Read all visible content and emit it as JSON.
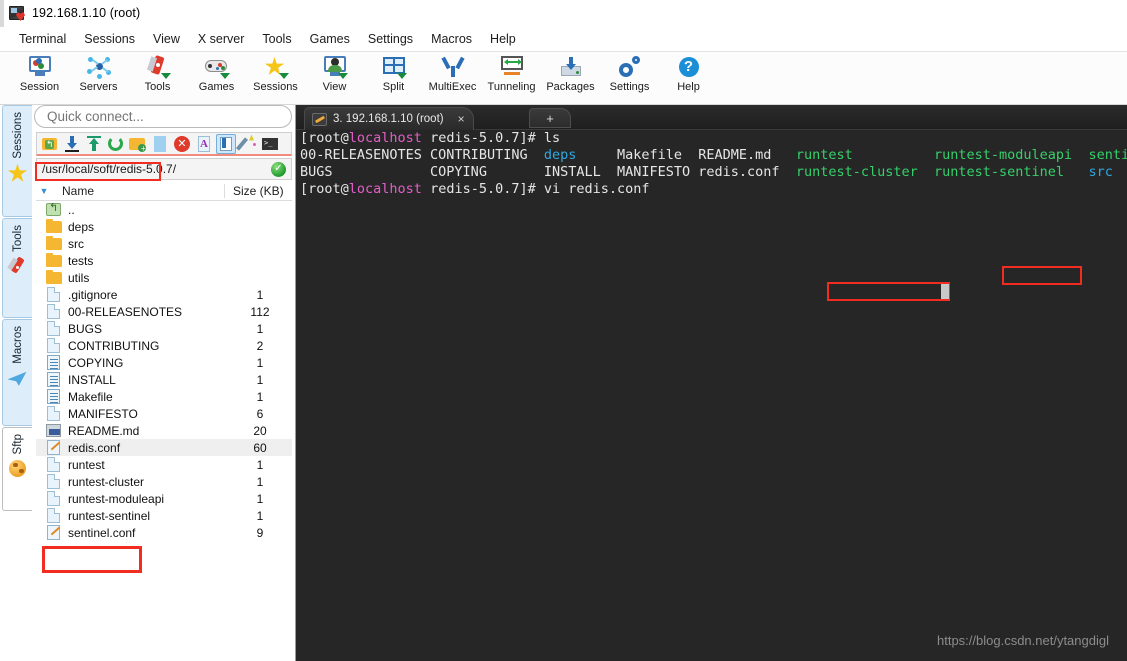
{
  "window": {
    "title": "192.168.1.10 (root)",
    "app_icon": "mobaxterm-icon"
  },
  "menubar": {
    "items": [
      {
        "label": "Terminal"
      },
      {
        "label": "Sessions"
      },
      {
        "label": "View"
      },
      {
        "label": "X server"
      },
      {
        "label": "Tools"
      },
      {
        "label": "Games"
      },
      {
        "label": "Settings"
      },
      {
        "label": "Macros"
      },
      {
        "label": "Help"
      }
    ]
  },
  "toolbar": {
    "buttons": [
      {
        "label": "Session",
        "icon": "session-monitor-icon"
      },
      {
        "label": "Servers",
        "icon": "servers-network-icon"
      },
      {
        "label": "Tools",
        "icon": "tools-swissknife-icon"
      },
      {
        "label": "Games",
        "icon": "games-gamepad-icon"
      },
      {
        "label": "Sessions",
        "icon": "sessions-star-icon"
      },
      {
        "label": "View",
        "icon": "view-user-monitor-icon"
      },
      {
        "label": "Split",
        "icon": "split-panes-icon"
      },
      {
        "label": "MultiExec",
        "icon": "multiexec-fork-icon"
      },
      {
        "label": "Tunneling",
        "icon": "tunneling-monitor-arrows-icon"
      },
      {
        "label": "Packages",
        "icon": "packages-download-box-icon"
      },
      {
        "label": "Settings",
        "icon": "settings-gears-icon"
      },
      {
        "label": "Help",
        "icon": "help-question-icon"
      }
    ]
  },
  "side_tabs": {
    "collapse_icon": "double-chevron-left-icon",
    "items": [
      {
        "label": "Sessions",
        "icon": "star-icon",
        "active": false
      },
      {
        "label": "Tools",
        "icon": "swissknife-icon",
        "active": false
      },
      {
        "label": "Macros",
        "icon": "paperplane-icon",
        "active": false
      },
      {
        "label": "Sftp",
        "icon": "globe-icon",
        "active": true
      }
    ]
  },
  "sftp_panel": {
    "quick_connect": {
      "value": "",
      "placeholder": "Quick connect..."
    },
    "toolbar_icons": [
      {
        "name": "parent-folder-icon",
        "selected": false
      },
      {
        "name": "download-icon",
        "selected": false
      },
      {
        "name": "upload-icon",
        "selected": false
      },
      {
        "name": "refresh-icon",
        "selected": false
      },
      {
        "name": "new-folder-icon",
        "selected": false
      },
      {
        "name": "new-file-icon",
        "selected": false
      },
      {
        "name": "delete-icon",
        "selected": false
      },
      {
        "name": "text-mode-icon",
        "selected": false
      },
      {
        "name": "follow-terminal-folder-icon",
        "selected": true
      },
      {
        "name": "magic-wand-icon",
        "selected": false
      },
      {
        "name": "open-terminal-icon",
        "selected": false
      }
    ],
    "path": {
      "value": "/usr/local/soft/redis-5.0.7/",
      "status_icon": "ok-check-icon",
      "highlighted": true
    },
    "columns": [
      "Name",
      "Size (KB)"
    ],
    "sort_caret": "▼",
    "files": [
      {
        "name": "..",
        "size": "",
        "type": "parent",
        "selected": false
      },
      {
        "name": "deps",
        "size": "",
        "type": "folder",
        "selected": false
      },
      {
        "name": "src",
        "size": "",
        "type": "folder",
        "selected": false
      },
      {
        "name": "tests",
        "size": "",
        "type": "folder",
        "selected": false
      },
      {
        "name": "utils",
        "size": "",
        "type": "folder",
        "selected": false
      },
      {
        "name": ".gitignore",
        "size": "1",
        "type": "file",
        "selected": false
      },
      {
        "name": "00-RELEASENOTES",
        "size": "112",
        "type": "file",
        "selected": false
      },
      {
        "name": "BUGS",
        "size": "1",
        "type": "file",
        "selected": false
      },
      {
        "name": "CONTRIBUTING",
        "size": "2",
        "type": "file",
        "selected": false
      },
      {
        "name": "COPYING",
        "size": "1",
        "type": "text",
        "selected": false
      },
      {
        "name": "INSTALL",
        "size": "1",
        "type": "text",
        "selected": false
      },
      {
        "name": "Makefile",
        "size": "1",
        "type": "text",
        "selected": false
      },
      {
        "name": "MANIFESTO",
        "size": "6",
        "type": "file",
        "selected": false
      },
      {
        "name": "README.md",
        "size": "20",
        "type": "markdown",
        "selected": false
      },
      {
        "name": "redis.conf",
        "size": "60",
        "type": "conf",
        "selected": true
      },
      {
        "name": "runtest",
        "size": "1",
        "type": "file",
        "selected": false
      },
      {
        "name": "runtest-cluster",
        "size": "1",
        "type": "file",
        "selected": false
      },
      {
        "name": "runtest-moduleapi",
        "size": "1",
        "type": "file",
        "selected": false
      },
      {
        "name": "runtest-sentinel",
        "size": "1",
        "type": "file",
        "selected": false
      },
      {
        "name": "sentinel.conf",
        "size": "9",
        "type": "conf",
        "selected": false
      }
    ]
  },
  "terminal": {
    "tab": {
      "label": "3. 192.168.1.10 (root)",
      "icon": "key-icon",
      "close_icon": "×",
      "new_tab_icon": "+"
    },
    "lines": [
      [
        {
          "text": "[root@",
          "color": "white"
        },
        {
          "text": "localhost",
          "color": "pink"
        },
        {
          "text": " redis-5.0.7]# ls",
          "color": "white"
        }
      ],
      [
        {
          "text": "00-RELEASENOTES ",
          "color": "white"
        },
        {
          "text": "CONTRIBUTING  ",
          "color": "white"
        },
        {
          "text": "deps     ",
          "color": "blue"
        },
        {
          "text": "Makefile  ",
          "color": "white"
        },
        {
          "text": "README.md   ",
          "color": "white"
        },
        {
          "text": "runtest          ",
          "color": "green"
        },
        {
          "text": "runtest-moduleapi  ",
          "color": "green"
        },
        {
          "text": "senti",
          "color": "green"
        }
      ],
      [
        {
          "text": "BUGS            ",
          "color": "white"
        },
        {
          "text": "COPYING       ",
          "color": "white"
        },
        {
          "text": "INSTALL  ",
          "color": "white"
        },
        {
          "text": "MANIFESTO ",
          "color": "white"
        },
        {
          "text": "redis.conf  ",
          "color": "white"
        },
        {
          "text": "runtest-cluster  ",
          "color": "green"
        },
        {
          "text": "runtest-sentinel   ",
          "color": "green"
        },
        {
          "text": "src",
          "color": "blue"
        }
      ],
      [
        {
          "text": "[root@",
          "color": "white"
        },
        {
          "text": "localhost",
          "color": "pink"
        },
        {
          "text": " redis-5.0.7]# ",
          "color": "white"
        },
        {
          "text": "vi redis.conf",
          "color": "white"
        }
      ]
    ],
    "highlight_boxes": [
      "redis.conf",
      "vi redis.conf"
    ],
    "cursor": "block"
  },
  "watermark": {
    "text": "https://blog.csdn.net/ytangdigl"
  },
  "colors": {
    "accent_blue": "#2a7ac0",
    "highlight_red": "#f02d20",
    "terminal_bg": "#262626",
    "terminal_green": "#35d06a",
    "terminal_blue": "#2fa8e0",
    "terminal_pink": "#e45ec9",
    "folder_yellow": "#f5b731"
  }
}
